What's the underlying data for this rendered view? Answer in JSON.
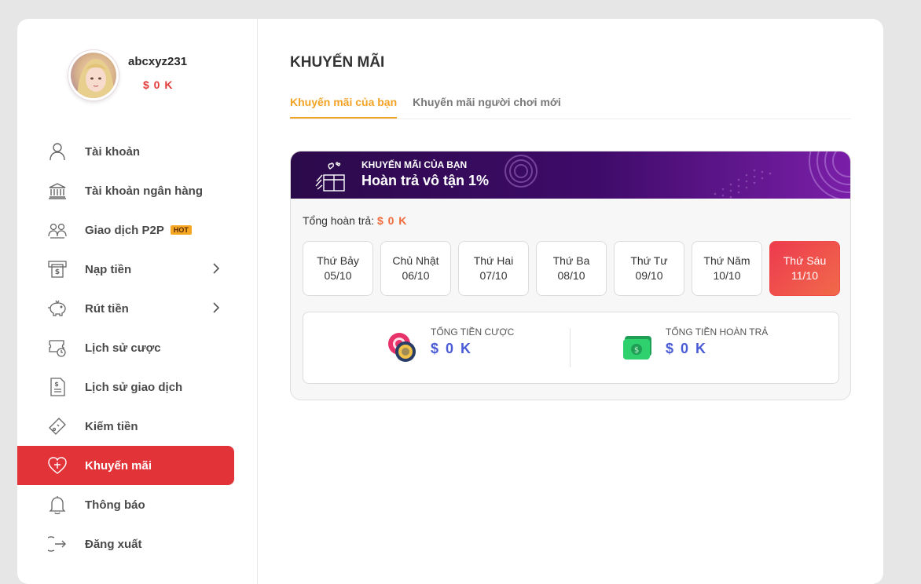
{
  "profile": {
    "username": "abcxyz231",
    "balance": "$ 0 K"
  },
  "menu": [
    {
      "label": "Tài khoản",
      "icon": "user-icon"
    },
    {
      "label": "Tài khoản ngân hàng",
      "icon": "bank-icon"
    },
    {
      "label": "Giao dịch P2P",
      "icon": "p2p-icon",
      "badge": "HOT"
    },
    {
      "label": "Nạp tiền",
      "icon": "atm-icon",
      "chevron": true
    },
    {
      "label": "Rút tiền",
      "icon": "piggy-bank-icon",
      "chevron": true
    },
    {
      "label": "Lịch sử cược",
      "icon": "ticket-history-icon"
    },
    {
      "label": "Lịch sử giao dịch",
      "icon": "receipt-icon"
    },
    {
      "label": "Kiếm tiền",
      "icon": "coupon-icon"
    },
    {
      "label": "Khuyến mãi",
      "icon": "heart-gift-icon",
      "active": true
    },
    {
      "label": "Thông báo",
      "icon": "bell-icon"
    },
    {
      "label": "Đăng xuất",
      "icon": "logout-icon"
    }
  ],
  "main": {
    "title": "KHUYẾN MÃI",
    "tabs": [
      {
        "label": "Khuyến mãi của bạn",
        "active": true
      },
      {
        "label": "Khuyến mãi người chơi mới"
      }
    ],
    "banner": {
      "subtitle": "KHUYẾN MÃI CỦA BẠN",
      "title": "Hoàn trả vô tận 1%"
    },
    "total_label": "Tổng hoàn trả:",
    "total_value": "$ 0 K",
    "days": [
      {
        "name": "Thứ Bảy",
        "date": "05/10"
      },
      {
        "name": "Chủ Nhật",
        "date": "06/10"
      },
      {
        "name": "Thứ Hai",
        "date": "07/10"
      },
      {
        "name": "Thứ Ba",
        "date": "08/10"
      },
      {
        "name": "Thứ Tư",
        "date": "09/10"
      },
      {
        "name": "Thứ Năm",
        "date": "10/10"
      },
      {
        "name": "Thứ Sáu",
        "date": "11/10",
        "active": true
      }
    ],
    "stats": [
      {
        "label": "TỔNG TIỀN CƯỢC",
        "value": "$ 0 K",
        "icon": "casino-chips-icon"
      },
      {
        "label": "TỔNG TIỀN HOÀN TRẢ",
        "value": "$ 0 K",
        "icon": "cash-icon"
      }
    ]
  },
  "colors": {
    "accent_red": "#e23338",
    "tab_active": "#f2a325",
    "value_blue": "#4a5bd6",
    "banner": "#3f0b6a"
  }
}
